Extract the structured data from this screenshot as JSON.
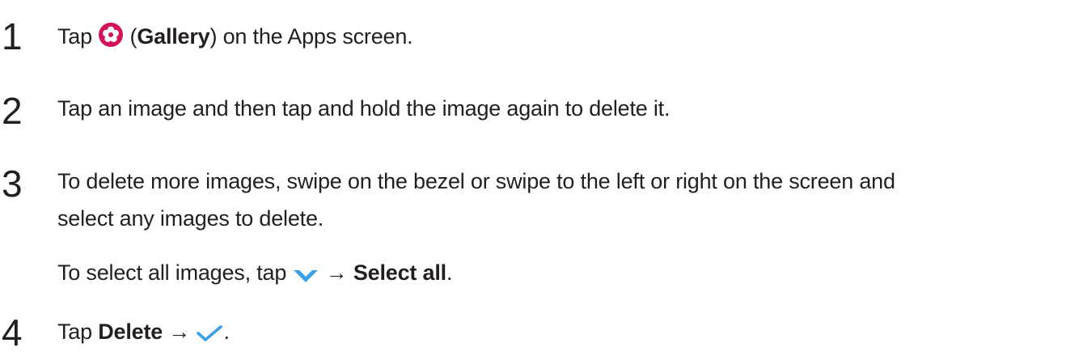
{
  "steps": [
    {
      "number": "1",
      "before": "Tap ",
      "icon": "gallery-app-icon",
      "paren_open": " (",
      "bold": "Gallery",
      "after": ") on the Apps screen."
    },
    {
      "number": "2",
      "text": "Tap an image and then tap and hold the image again to delete it."
    },
    {
      "number": "3",
      "line1": "To delete more images, swipe on the bezel or swipe to the left or right on the screen and",
      "line2": "select any images to delete.",
      "sub_before": "To select all images, tap ",
      "sub_icon": "more-options-chevron-icon",
      "sub_arrow": " → ",
      "sub_bold": "Select all",
      "sub_after": "."
    },
    {
      "number": "4",
      "before": "Tap ",
      "bold": "Delete",
      "arrow": " → ",
      "icon": "checkmark-icon",
      "after": "."
    }
  ],
  "colors": {
    "text": "#231f20",
    "gallery_icon": "#d4145a",
    "accent_blue": "#3aa0e8"
  }
}
